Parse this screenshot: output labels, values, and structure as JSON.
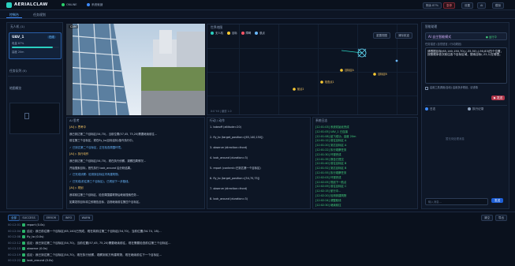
{
  "app": {
    "title": "AERIALCLAW",
    "status_online": "ONLINE",
    "status_sim": "系统就绪",
    "battery": "剩余 87%",
    "header_buttons": [
      "急停",
      "设置",
      "AI",
      "模拟"
    ]
  },
  "tabs": [
    "控制台",
    "任务规划"
  ],
  "left": {
    "fleet_header": "无人机 (1)",
    "uav_name": "UAV_1",
    "uav_badge": "在线",
    "uav_stats": [
      "电量 87%",
      "高度 20m"
    ],
    "battery_fraction": 0.87,
    "section2": "任务队列 (0)",
    "section3": "地图概览"
  },
  "map": {
    "header": "世界地图",
    "legend": [
      "无人机",
      "目标",
      "障碍",
      "航点"
    ],
    "buttons": [
      "重置视图",
      "清除航迹"
    ],
    "points": [
      "起点",
      "目标区A",
      "目标区B",
      "检查点1",
      "航点2"
    ],
    "footer": "X:0  Y:0  |  缩放 1.0"
  },
  "right": {
    "header": "智能助理",
    "mode": "AI 自主智能模式",
    "mode_badge": "● 运行中",
    "subtitle": "任务描述 (自然语言 / 行动规划)",
    "prompt": "请根据目标(65,140,150,70),(-35,50),(-90,83)四个位置，按照顺序依次前往各个目标区域，搜索目标(-22,1)在哪里。",
    "checkbox_label": "启用工具调用(自动) 启用多步规划，请谨慎",
    "send": "▶ 发送",
    "col_a": "日志",
    "col_b": "执行记录",
    "empty": "暂无待处理消息",
    "input_placeholder": "输入消息...",
    "send2": "发送"
  },
  "log": {
    "col1_header": "AI 思考",
    "col2_header": "行动 / 动作",
    "col3_header": "系统日志",
    "col1": [
      "[AI] ▷ 思考中",
      "我已到达第二个目标区(54,70)，当前位置(57,45, 75,20)需要继续前往...",
      "前往第三个目标区，现在fly_to(目标坐标)指令执行中。",
      "✓ 已到达第二个目标区，正在检查周围环境。",
      "[AI] ▷ 执行动作",
      "我已到达第二个目标区(54,70)，现在执行侦察，观察四周情况...",
      "开始搜索目标，首先执行 look_around 后分析结果。",
      "✓ 已完成侦察：检测到目标区内有建筑物。",
      "✓ 已完成(前往第三个目标区)、已规划下一步路线。",
      "[AI] ▷ 规划",
      "我将前往第三个目标区，检查周围建筑物后继续搜索任务...",
      "如果发现目标将立即报告坐标，否则继续前往第四个目标区。"
    ],
    "col2": [
      "1. takeoff (altitude=20)",
      "2. fly_to (target_position=[65,140,150])",
      "3. observe (direction=front)",
      "4. look_around (duration=3)",
      "5. report (content=已到达第一个目标区)",
      "6. fly_to (target_position=[54,70,75])",
      "7. observe (direction=front)",
      "8. look_around (duration=3)"
    ],
    "col3": [
      "[12:01:03] 系统初始化完成",
      "[12:01:05] UAV_1 已连接",
      "[12:01:08] 起飞成功，高度 20m",
      "[12:01:12] 前往目标区 A",
      "[12:01:20] 到达目标区 A",
      "[12:01:22] 执行观察任务",
      "[12:01:30] 环视完成",
      "[12:01:35] 报告已提交",
      "[12:01:40] 前往目标区 B",
      "[12:01:52] 到达目标区 B",
      "[12:01:55] 执行观察任务",
      "[12:02:03] 环视完成",
      "[12:02:05] 规划下一航点",
      "[12:02:09] 前往目标区 C",
      "[12:02:15] 航行中...",
      "[12:02:20] 检测到建筑物",
      "[12:02:24] 调整航线",
      "[12:02:30] 继续前往"
    ]
  },
  "terminal": {
    "tabs": [
      "全部",
      "SUCCESS",
      "ERROR",
      "INFO",
      "WARN"
    ],
    "right_buttons": [
      "清空",
      "导出"
    ],
    "lines": [
      {
        "ts": "00:12:01",
        "text": "report (0.0s)"
      },
      {
        "ts": "00:12:04",
        "text": "结论：我已前往第一个目标区(65,140)已完成，现在将前往第二个目标区(54,70)，当前位置(54.74, 18)..."
      },
      {
        "ts": "00:12:08",
        "text": "fly_to (0.0s)"
      },
      {
        "ts": "00:12:12",
        "text": "结论：我已到达第二个目标区(54,70)，当前位置(57,45, 75,20)需要继续前往，现在需要检查前往第三个目标区..."
      },
      {
        "ts": "00:12:15",
        "text": "observe (0.0s)"
      },
      {
        "ts": "00:12:19",
        "text": "结论：我已到达第二个目标区(54,70)，现在执行侦察，观察到前方有建筑物，现在继续前往下一个目标区..."
      },
      {
        "ts": "00:12:22",
        "text": "look_around (0.0s)"
      }
    ]
  }
}
